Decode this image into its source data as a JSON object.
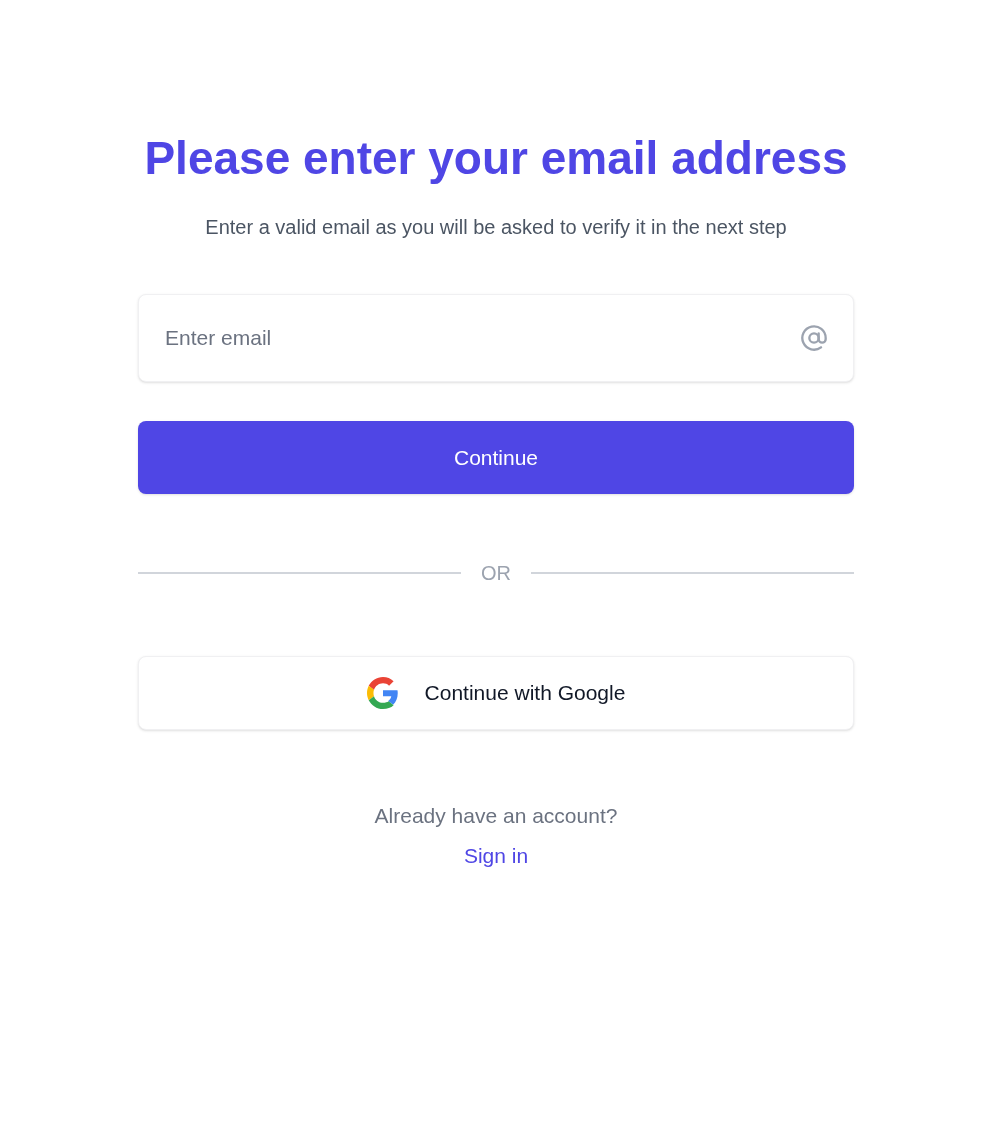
{
  "title": "Please enter your email address",
  "subtitle": "Enter a valid email as you will be asked to verify it in the next step",
  "email_field": {
    "placeholder": "Enter email"
  },
  "continue_button": "Continue",
  "divider": "OR",
  "google_button": "Continue with Google",
  "footer": {
    "prompt": "Already have an account?",
    "link": "Sign in"
  }
}
